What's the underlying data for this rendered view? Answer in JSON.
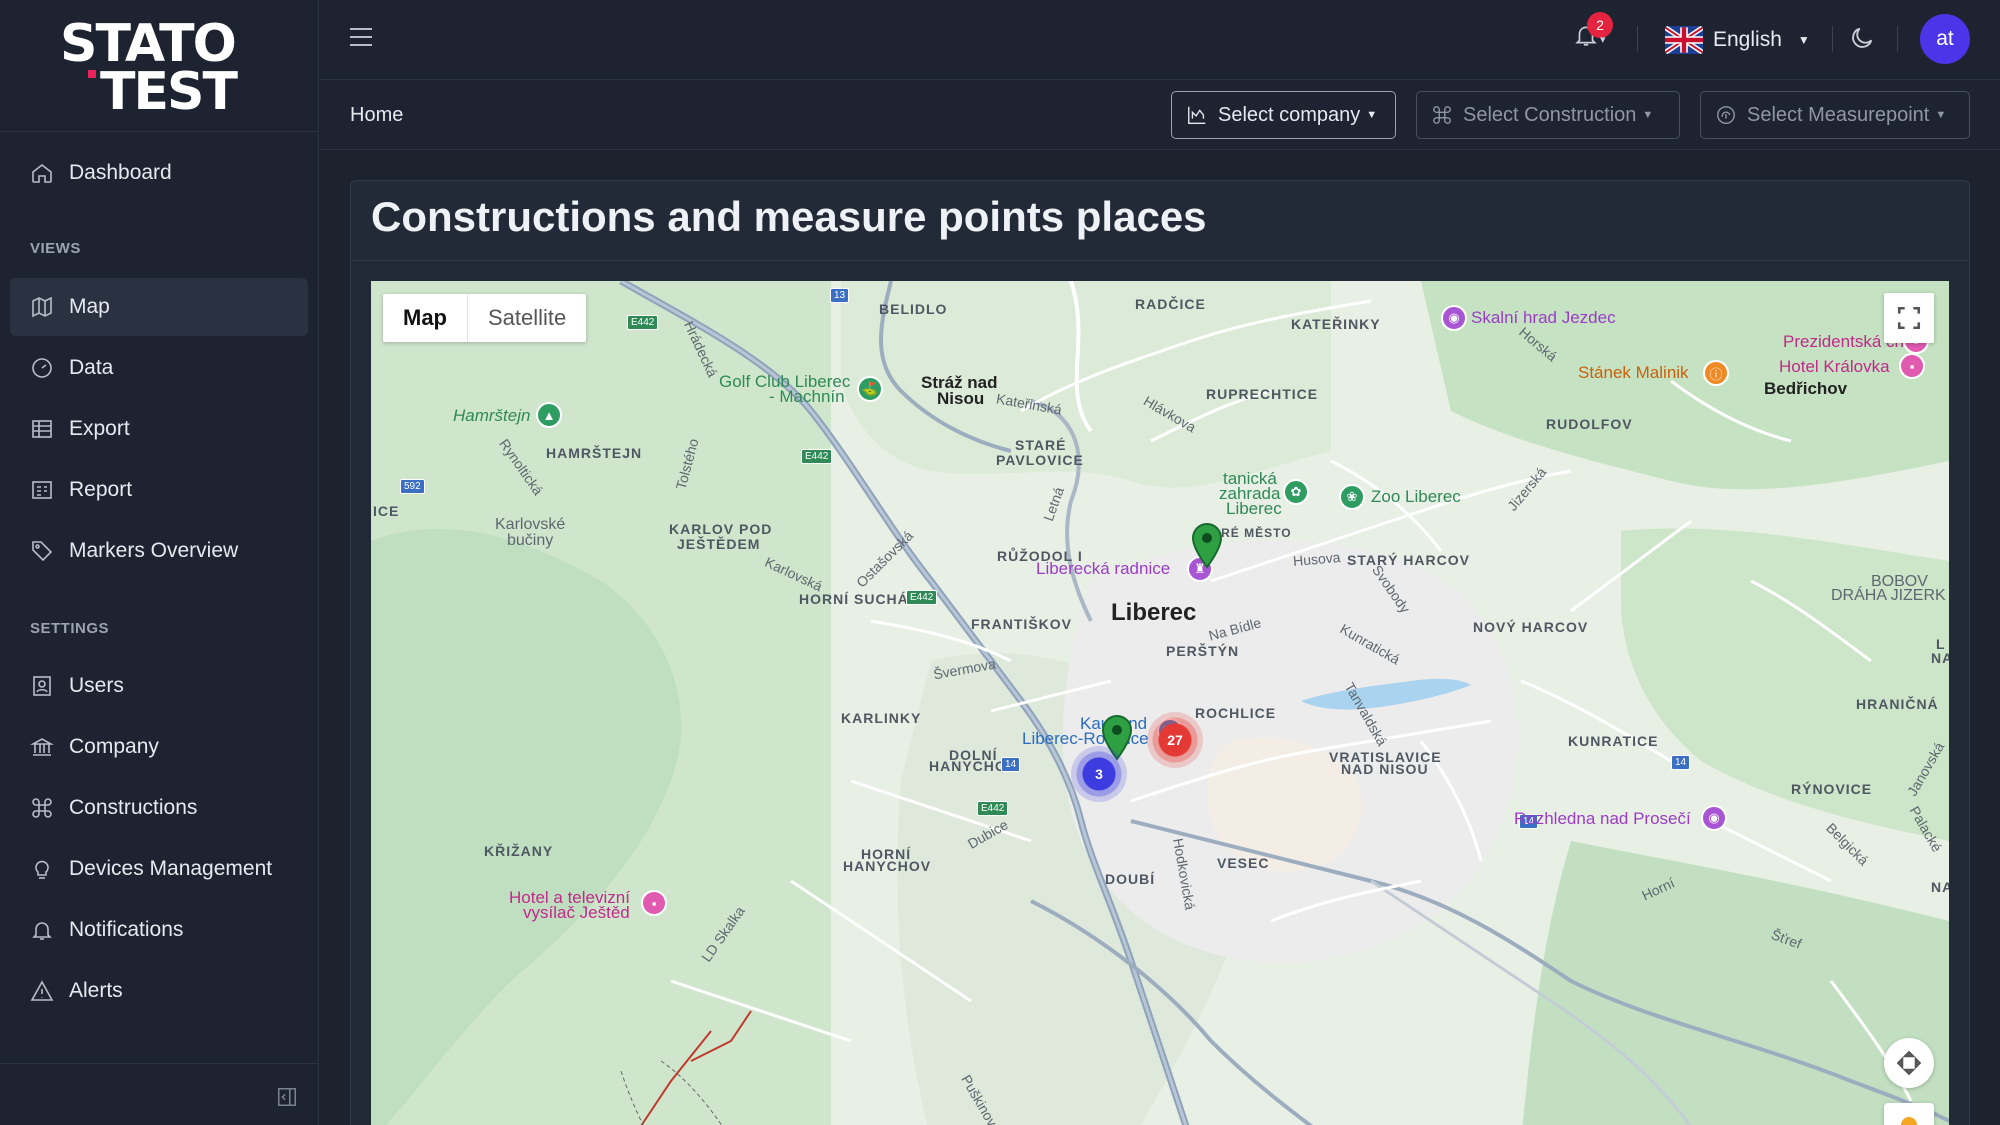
{
  "brand": {
    "line1": "STATO",
    "line2": "TEST"
  },
  "sidebar": {
    "items": [
      {
        "label": "Dashboard",
        "icon": "home-icon"
      },
      {
        "label": "Map",
        "icon": "map-icon",
        "active": true
      },
      {
        "label": "Data",
        "icon": "gauge-icon"
      },
      {
        "label": "Export",
        "icon": "table-icon"
      },
      {
        "label": "Report",
        "icon": "report-icon"
      },
      {
        "label": "Markers Overview",
        "icon": "tag-icon"
      },
      {
        "label": "Users",
        "icon": "users-icon"
      },
      {
        "label": "Company",
        "icon": "building-icon"
      },
      {
        "label": "Constructions",
        "icon": "command-icon"
      },
      {
        "label": "Devices Management",
        "icon": "bulb-icon"
      },
      {
        "label": "Notifications",
        "icon": "bell-icon"
      },
      {
        "label": "Alerts",
        "icon": "alert-triangle-icon"
      }
    ],
    "sections": {
      "views": "VIEWS",
      "settings": "SETTINGS"
    }
  },
  "topbar": {
    "notification_count": "2",
    "language": "English",
    "avatar_initials": "at"
  },
  "subbar": {
    "breadcrumb": "Home",
    "select_company": "Select company",
    "select_construction": "Select Construction",
    "select_measurepoint": "Select Measurepoint"
  },
  "page": {
    "title": "Constructions and measure points places"
  },
  "map": {
    "type_options": [
      "Map",
      "Satellite"
    ],
    "selected_type": "Map",
    "clusters": [
      {
        "count": "27",
        "color": "#e53935"
      },
      {
        "count": "3",
        "color": "#3c3ce0"
      }
    ],
    "labels": {
      "belidlo": "BELIDLO",
      "radcice": "RADČICE",
      "katerinky": "KATEŘINKY",
      "ruprechtice": "RUPRECHTICE",
      "rudolfov": "RUDOLFOV",
      "bedrichov": "Bedřichov",
      "straz1": "Stráž nad",
      "straz2": "Nisou",
      "hamrstejn_upper": "HAMRŠTEJN",
      "stare_pavlovice1": "STARÉ",
      "stare_pavlovice2": "PAVLOVICE",
      "ice": "ICE",
      "karlovske1": "Karlovské",
      "karlovske2": "bučiny",
      "karlov1": "KARLOV POD",
      "karlov2": "JEŠTĚDEM",
      "stare_mesto": "STARÉ MĚSTO",
      "stary_harcov": "STARÝ HARCOV",
      "rudzol": "RŮŽODOL I",
      "horni_sucha": "HORNÍ SUCHÁ",
      "frantiskov": "FRANTIŠKOV",
      "liberec": "Liberec",
      "perstyn": "PERŠTÝN",
      "novy_harcov": "NOVÝ HARCOV",
      "bobov1": "BOBOV",
      "bobov2": "DRÁHA JIZERK",
      "rochlice": "ROCHLICE",
      "karlinky": "KARLINKY",
      "dolni1": "DOLNÍ",
      "dolni2": "HANYCHOV",
      "vratislavice1": "VRATISLAVICE",
      "vratislavice2": "NAD NISOU",
      "kunratice": "KUNRATICE",
      "hranicna": "HRANIČNÁ",
      "rynovice": "RÝNOVICE",
      "krizany": "KŘIŽANY",
      "horni_h1": "HORNÍ",
      "horni_h2": "HANYCHOV",
      "vesec": "VESEC",
      "doubi": "DOUBÍ",
      "le": "L",
      "na": "NA",
      "na2": "NA"
    },
    "streets": {
      "hradecka": "Hrádecká",
      "rynolticka": "Rynoltická",
      "tolstego": "Tolstého",
      "katerinska": "Kateřinská",
      "hlavkova": "Hlávkova",
      "letna": "Letná",
      "horska": "Horská",
      "jizerska": "Jizerská",
      "husova": "Husova",
      "svobody": "Svobody",
      "karlovska": "Karlovská",
      "ostasovska": "Ostašovská",
      "na_bidle": "Na Bídle",
      "kunraticka": "Kunratická",
      "svermova": "Švermova",
      "tanvaldska": "Tanvaldská",
      "dubice": "Dubice",
      "hodkovicka": "Hodkovická",
      "puskinova": "Puškinova",
      "janovska": "Janovská",
      "palacke": "Palacké",
      "belgicka": "Belgická",
      "horni": "Horní",
      "skalka": "LD Skalka",
      "stref": "Šťref"
    },
    "pois": {
      "skalni": "Skalní hrad Jezdec",
      "prezidentska": "Prezidentská chata",
      "hotel_kralovka": "Hotel Královka",
      "stanek": "Stánek Malinik",
      "golf1": "Golf Club Liberec",
      "golf2": "- Machnín",
      "hamrstejn": "Hamrštejn",
      "botanicka1": "tanická",
      "botanicka2": "zahrada",
      "botanicka3": "Liberec",
      "zoo": "Zoo Liberec",
      "radnice": "Liberecká radnice",
      "kaufland1": "Kaufland",
      "kaufland2": "Liberec-Rochlice",
      "rozhledna": "Rozhledna nad Prosečí",
      "hotel_tv1": "Hotel a televizní",
      "hotel_tv2": "vysílač Ještěd"
    },
    "shields": {
      "e442a": "E442",
      "e442b": "E442",
      "e442c": "E442",
      "e442d": "E442",
      "r13": "13",
      "r14a": "14",
      "r14b": "14",
      "r14c": "14",
      "r592": "592"
    }
  }
}
